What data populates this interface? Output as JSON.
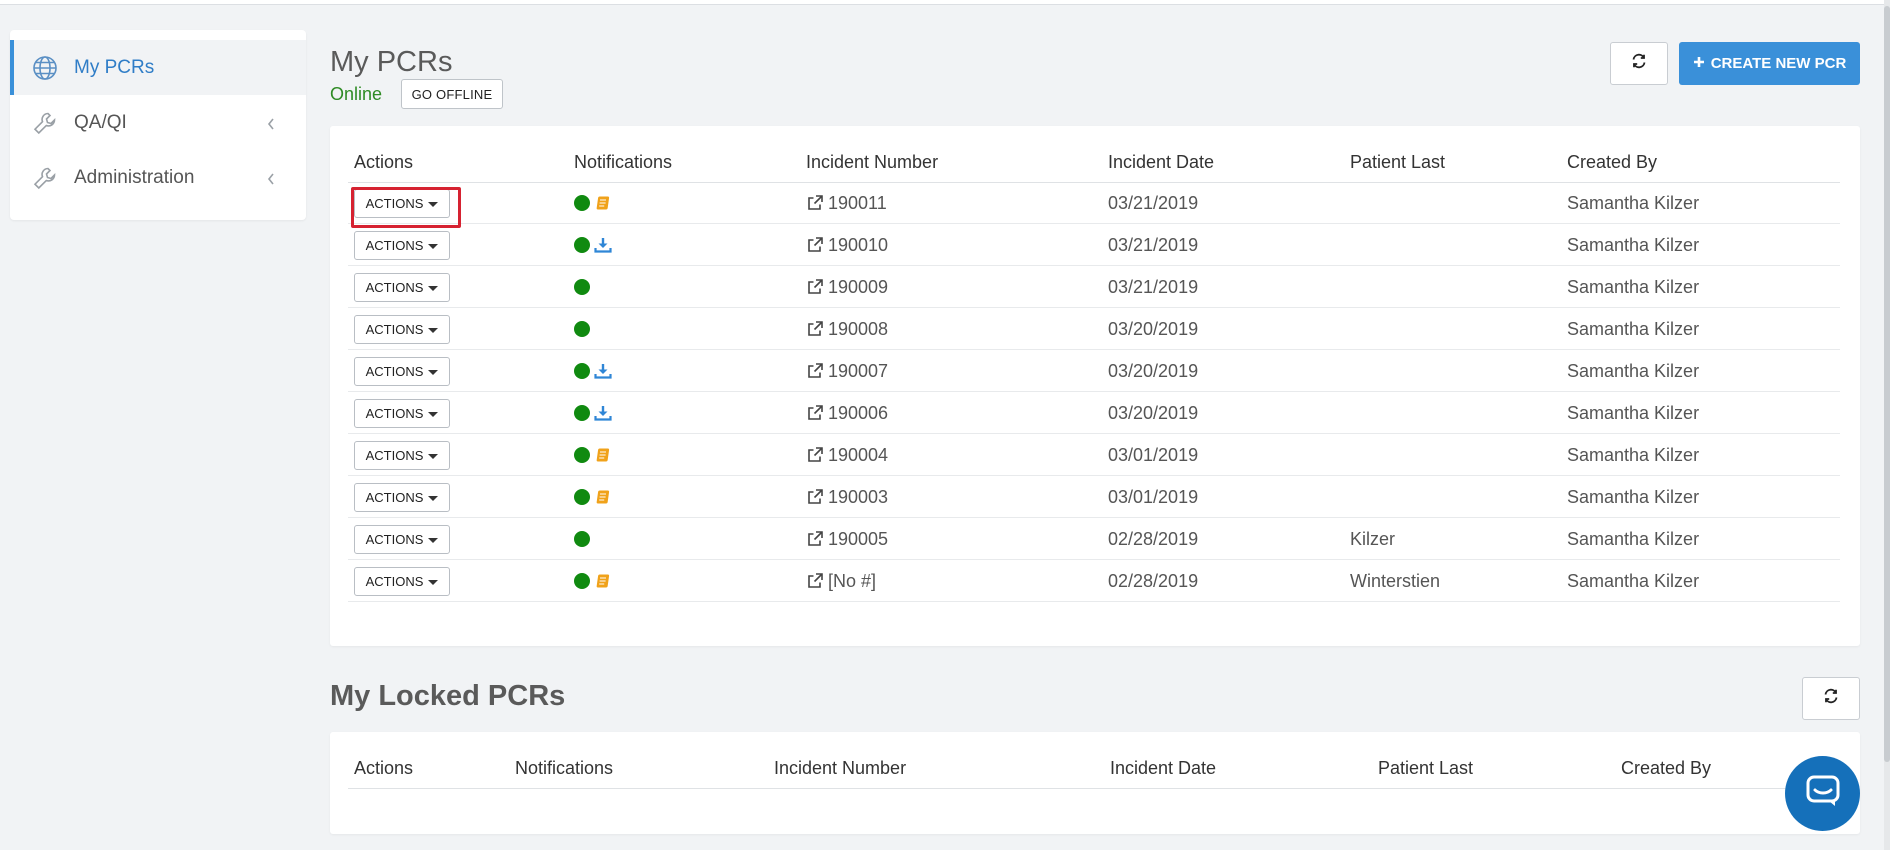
{
  "sidebar": {
    "items": [
      {
        "label": "My PCRs",
        "icon": "globe-icon",
        "active": true
      },
      {
        "label": "QA/QI",
        "icon": "wrench-icon",
        "active": false
      },
      {
        "label": "Administration",
        "icon": "wrench-icon",
        "active": false
      }
    ]
  },
  "main": {
    "title": "My PCRs",
    "status": "Online",
    "go_offline_label": "GO OFFLINE",
    "create_label": "CREATE NEW PCR",
    "columns": [
      "Actions",
      "Notifications",
      "Incident Number",
      "Incident Date",
      "Patient Last",
      "Created By"
    ],
    "action_label": "ACTIONS",
    "rows": [
      {
        "notifications": [
          "status-dot",
          "note-icon"
        ],
        "incident": "190011",
        "date": "03/21/2019",
        "patient": "",
        "created_by": "Samantha Kilzer"
      },
      {
        "notifications": [
          "status-dot",
          "download-icon"
        ],
        "incident": "190010",
        "date": "03/21/2019",
        "patient": "",
        "created_by": "Samantha Kilzer"
      },
      {
        "notifications": [
          "status-dot"
        ],
        "incident": "190009",
        "date": "03/21/2019",
        "patient": "",
        "created_by": "Samantha Kilzer"
      },
      {
        "notifications": [
          "status-dot"
        ],
        "incident": "190008",
        "date": "03/20/2019",
        "patient": "",
        "created_by": "Samantha Kilzer"
      },
      {
        "notifications": [
          "status-dot",
          "download-icon"
        ],
        "incident": "190007",
        "date": "03/20/2019",
        "patient": "",
        "created_by": "Samantha Kilzer"
      },
      {
        "notifications": [
          "status-dot",
          "download-icon"
        ],
        "incident": "190006",
        "date": "03/20/2019",
        "patient": "",
        "created_by": "Samantha Kilzer"
      },
      {
        "notifications": [
          "status-dot",
          "note-icon"
        ],
        "incident": "190004",
        "date": "03/01/2019",
        "patient": "",
        "created_by": "Samantha Kilzer"
      },
      {
        "notifications": [
          "status-dot",
          "note-icon"
        ],
        "incident": "190003",
        "date": "03/01/2019",
        "patient": "",
        "created_by": "Samantha Kilzer"
      },
      {
        "notifications": [
          "status-dot"
        ],
        "incident": "190005",
        "date": "02/28/2019",
        "patient": "Kilzer",
        "created_by": "Samantha Kilzer"
      },
      {
        "notifications": [
          "status-dot",
          "note-icon"
        ],
        "incident": "[No #]",
        "date": "02/28/2019",
        "patient": "Winterstien",
        "created_by": "Samantha Kilzer"
      }
    ]
  },
  "locked": {
    "title": "My Locked PCRs",
    "columns": [
      "Actions",
      "Notifications",
      "Incident Number",
      "Incident Date",
      "Patient Last",
      "Created By"
    ]
  },
  "colors": {
    "accent": "#3a90d9",
    "online": "#2e8b24",
    "status_dot": "#108a10",
    "note": "#f0a21a",
    "download": "#2f86d6",
    "highlight": "#d62231",
    "chat": "#1570ba"
  },
  "icons": {
    "refresh": "refresh-icon",
    "plus": "plus-icon",
    "external": "external-link-icon",
    "chat": "chat-icon",
    "chevron": "chevron-left-icon"
  }
}
